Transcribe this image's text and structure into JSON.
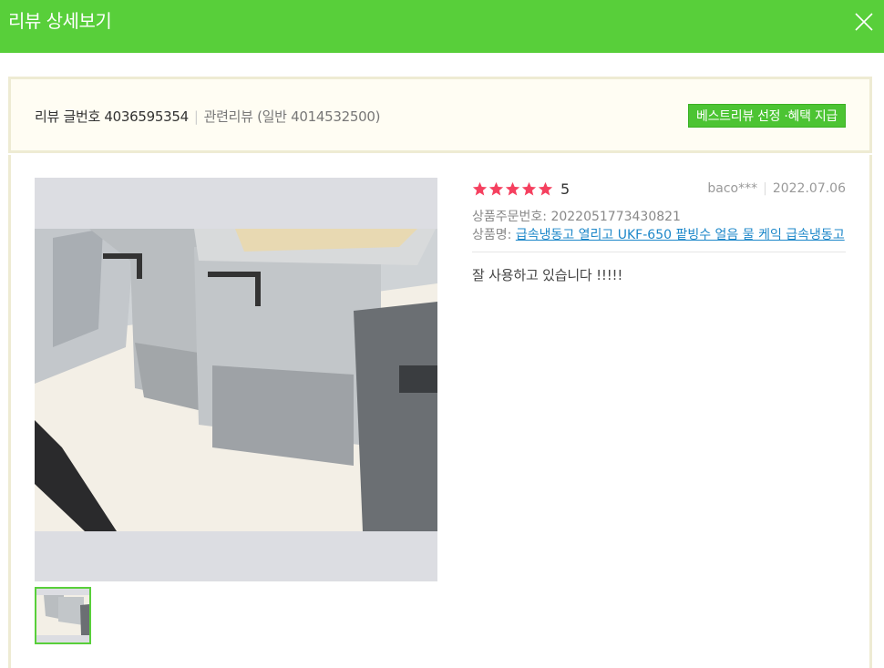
{
  "header": {
    "title": "리뷰 상세보기"
  },
  "info": {
    "review_no_label": "리뷰 글번호 4036595354",
    "related_label": "관련리뷰 (일반 4014532500)",
    "best_button": "베스트리뷰 선정 ·혜택 지급"
  },
  "review": {
    "stars": 5,
    "score": "5",
    "author": "baco***",
    "date": "2022.07.06",
    "order_label": "상품주문번호: 2022051773430821",
    "product_label": "상품명: ",
    "product_name": "급속냉동고 열리고 UKF-650 팥빙수 얼음 물 케익 급속냉동고",
    "text": "잘 사용하고 있습니다 !!!!!"
  },
  "colors": {
    "header_bg": "#58cf3a",
    "star": "#f5405f",
    "link": "#1c87c9"
  }
}
